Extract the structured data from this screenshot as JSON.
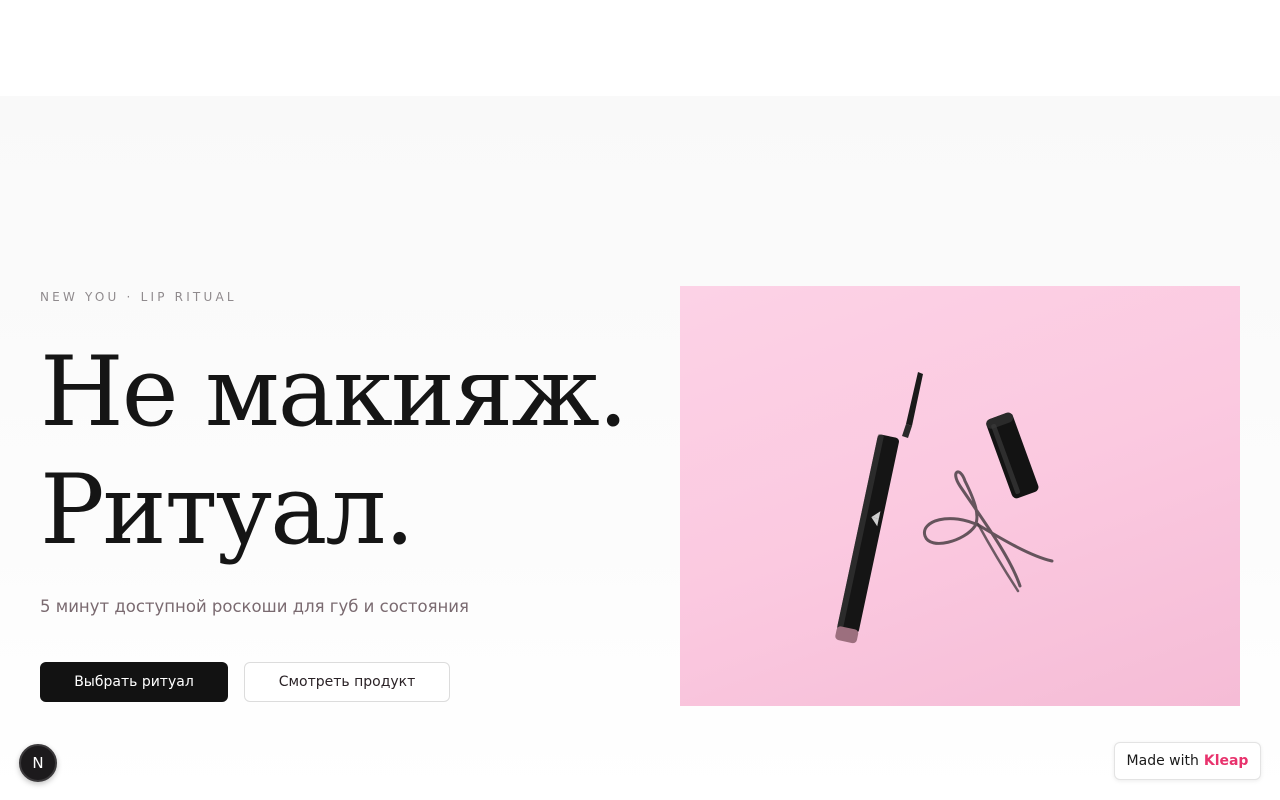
{
  "hero": {
    "eyebrow": "NEW YOU · LIP RITUAL",
    "headline_line1": "Не макияж.",
    "headline_line2": "Ритуал.",
    "subtitle": "5 минут доступной роскоши для губ и состояния",
    "primary_button": "Выбрать ритуал",
    "secondary_button": "Смотреть продукт"
  },
  "badge": {
    "letter": "N"
  },
  "footer_badge": {
    "prefix": "Made with",
    "brand": "Kleap"
  },
  "colors": {
    "accent_brand": "#e8336d",
    "image_background": "#fbc9e0",
    "primary_button": "#121212"
  }
}
